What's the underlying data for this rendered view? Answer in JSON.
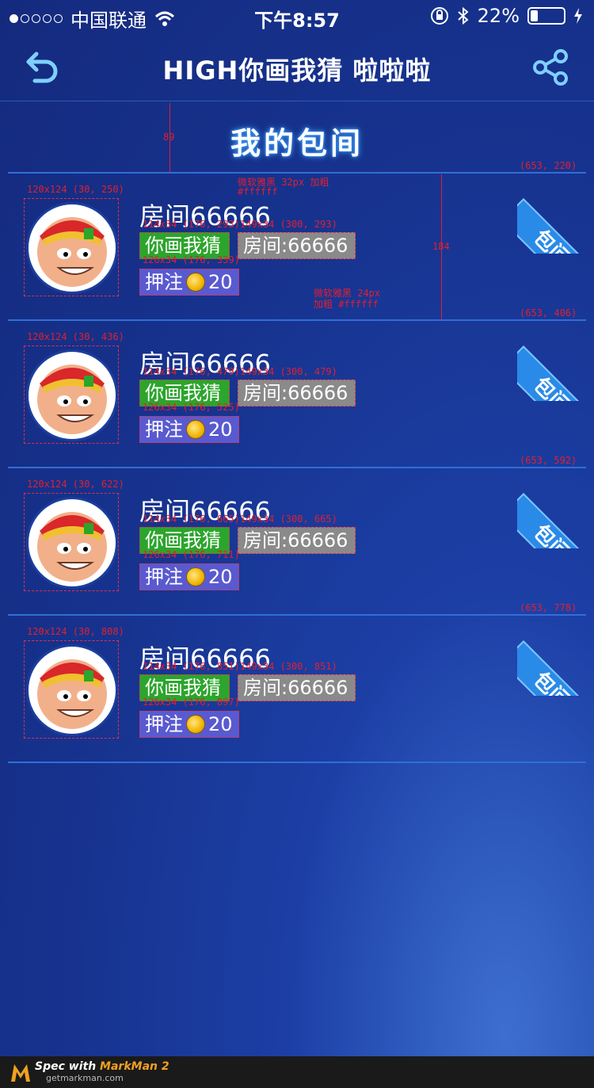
{
  "status_bar": {
    "carrier": "中国联通",
    "time": "下午8:57",
    "battery": "22%",
    "battery_level": 0.22
  },
  "header": {
    "title": "HIGH你画我猜 啦啦啦"
  },
  "section_title": "我的包间",
  "rooms": [
    {
      "name": "房间66666",
      "game_tag": "你画我猜",
      "room_tag": "房间:66666",
      "bet_label": "押注",
      "bet_value": "20",
      "ribbon": "包间",
      "anno_avatar": "120x124 (30, 250)",
      "anno_game": "114x34 (176, 293)",
      "anno_room": "149x34 (300, 293)",
      "anno_bet": "126x34 (176, 339)",
      "anno_ribbon": "(653, 220)"
    },
    {
      "name": "房间66666",
      "game_tag": "你画我猜",
      "room_tag": "房间:66666",
      "bet_label": "押注",
      "bet_value": "20",
      "ribbon": "包间",
      "anno_avatar": "120x124 (30, 436)",
      "anno_game": "114x34 (176, 479)",
      "anno_room": "149x34 (300, 479)",
      "anno_bet": "126x34 (176, 525)",
      "anno_ribbon": "(653, 406)"
    },
    {
      "name": "房间66666",
      "game_tag": "你画我猜",
      "room_tag": "房间:66666",
      "bet_label": "押注",
      "bet_value": "20",
      "ribbon": "包间",
      "anno_avatar": "120x124 (30, 622)",
      "anno_game": "114x34 (176, 665)",
      "anno_room": "149x34 (300, 665)",
      "anno_bet": "126x34 (176, 711)",
      "anno_ribbon": "(653, 592)"
    },
    {
      "name": "房间66666",
      "game_tag": "你画我猜",
      "room_tag": "房间:66666",
      "bet_label": "押注",
      "bet_value": "20",
      "ribbon": "包间",
      "anno_avatar": "120x124 (30, 808)",
      "anno_game": "114x34 (176, 851)",
      "anno_room": "149x34 (300, 851)",
      "anno_bet": "126x34 (176, 897)",
      "anno_ribbon": "(653, 778)"
    }
  ],
  "annotations": {
    "header_gap": "89",
    "row_height": "184",
    "font_note_1a": "微软雅黑 32px 加粗",
    "font_note_1b": "#ffffff",
    "font_note_2a": "微软雅黑 24px",
    "font_note_2b": "加粗 #ffffff"
  },
  "footer": {
    "spec_text": "Spec with",
    "brand": "MarkMan 2",
    "url": "getmarkman.com"
  },
  "colors": {
    "game_tag": "#2ca52c",
    "room_tag": "#8a8a8a",
    "bet_tag": "#5a5ad0",
    "ribbon": "#2a8ae8",
    "divider": "#2f6fd6"
  }
}
